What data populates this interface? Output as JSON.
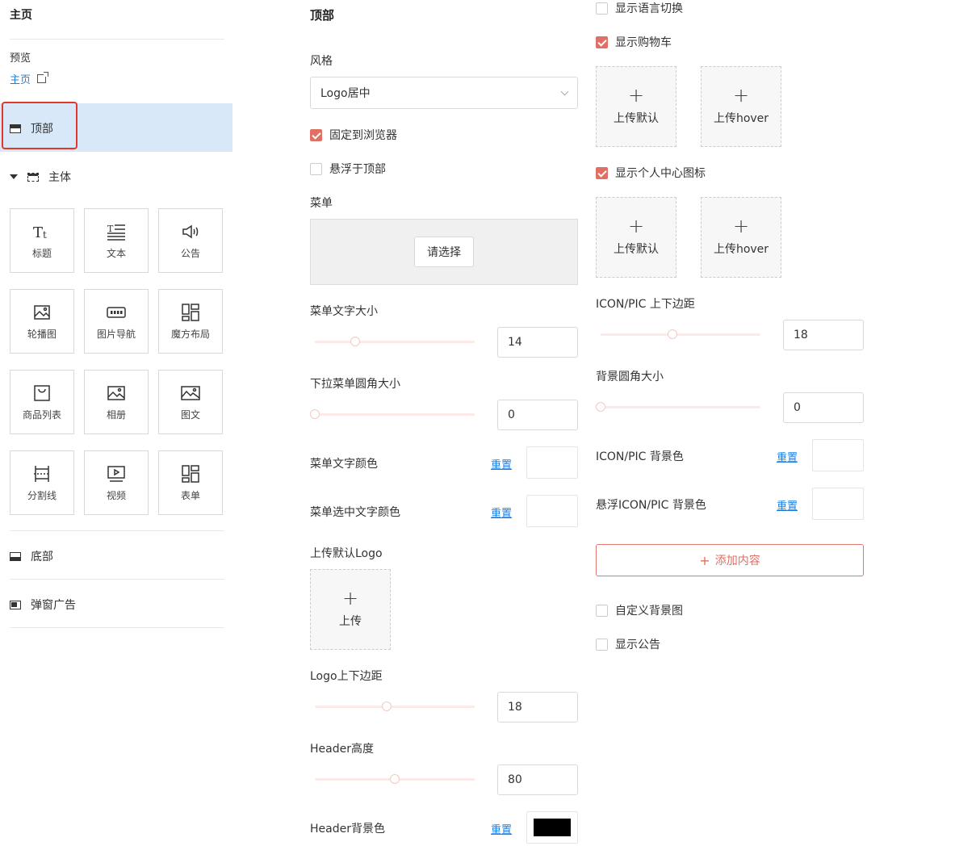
{
  "sidebar": {
    "title": "主页",
    "preview_label": "预览",
    "preview_link": "主页",
    "sections": {
      "top": "顶部",
      "main": "主体",
      "bottom": "底部",
      "popup": "弹窗广告"
    },
    "components": [
      {
        "label": "标题",
        "icon": "title-icon"
      },
      {
        "label": "文本",
        "icon": "text-icon"
      },
      {
        "label": "公告",
        "icon": "announcement-icon"
      },
      {
        "label": "轮播图",
        "icon": "carousel-icon"
      },
      {
        "label": "图片导航",
        "icon": "image-nav-icon"
      },
      {
        "label": "魔方布局",
        "icon": "cube-layout-icon"
      },
      {
        "label": "商品列表",
        "icon": "product-list-icon"
      },
      {
        "label": "相册",
        "icon": "album-icon"
      },
      {
        "label": "图文",
        "icon": "image-text-icon"
      },
      {
        "label": "分割线",
        "icon": "divider-icon"
      },
      {
        "label": "视频",
        "icon": "video-icon"
      },
      {
        "label": "表单",
        "icon": "form-icon"
      }
    ]
  },
  "main": {
    "title": "顶部",
    "style_label": "风格",
    "style_value": "Logo居中",
    "fixed_browser": {
      "label": "固定到浏览器",
      "checked": true
    },
    "float_top": {
      "label": "悬浮于顶部",
      "checked": false
    },
    "menu_label": "菜单",
    "menu_choose": "请选择",
    "menu_font_size": {
      "label": "菜单文字大小",
      "value": "14",
      "fraction": 0.25
    },
    "dropdown_radius": {
      "label": "下拉菜单圆角大小",
      "value": "0",
      "fraction": 0.0
    },
    "menu_text_color": {
      "label": "菜单文字颜色",
      "reset": "重置",
      "color": "#ffffff"
    },
    "menu_selected_color": {
      "label": "菜单选中文字颜色",
      "reset": "重置",
      "color": "#ffffff"
    },
    "upload_logo_label": "上传默认Logo",
    "upload_text": "上传",
    "logo_padding": {
      "label": "Logo上下边距",
      "value": "18",
      "fraction": 0.45
    },
    "header_height": {
      "label": "Header高度",
      "value": "80",
      "fraction": 0.5
    },
    "header_bg": {
      "label": "Header背景色",
      "reset": "重置",
      "color": "#000000"
    }
  },
  "right": {
    "show_lang": {
      "label": "显示语言切换",
      "checked": false
    },
    "show_cart": {
      "label": "显示购物车",
      "checked": true
    },
    "cart_upload_default": "上传默认",
    "cart_upload_hover": "上传hover",
    "show_user_icon": {
      "label": "显示个人中心图标",
      "checked": true
    },
    "user_upload_default": "上传默认",
    "user_upload_hover": "上传hover",
    "icon_padding": {
      "label": "ICON/PIC 上下边距",
      "value": "18",
      "fraction": 0.45
    },
    "bg_radius": {
      "label": "背景圆角大小",
      "value": "0",
      "fraction": 0.0
    },
    "icon_bg": {
      "label": "ICON/PIC 背景色",
      "reset": "重置",
      "color": "#ffffff"
    },
    "hover_icon_bg": {
      "label": "悬浮ICON/PIC 背景色",
      "reset": "重置",
      "color": "#ffffff"
    },
    "add_content": "添加内容",
    "custom_bg": {
      "label": "自定义背景图",
      "checked": false
    },
    "show_notice": {
      "label": "显示公告",
      "checked": false
    }
  },
  "colors": {
    "accent": "#e06f64",
    "link": "#1a7fe6",
    "selected_bg": "#d9e8f8"
  }
}
